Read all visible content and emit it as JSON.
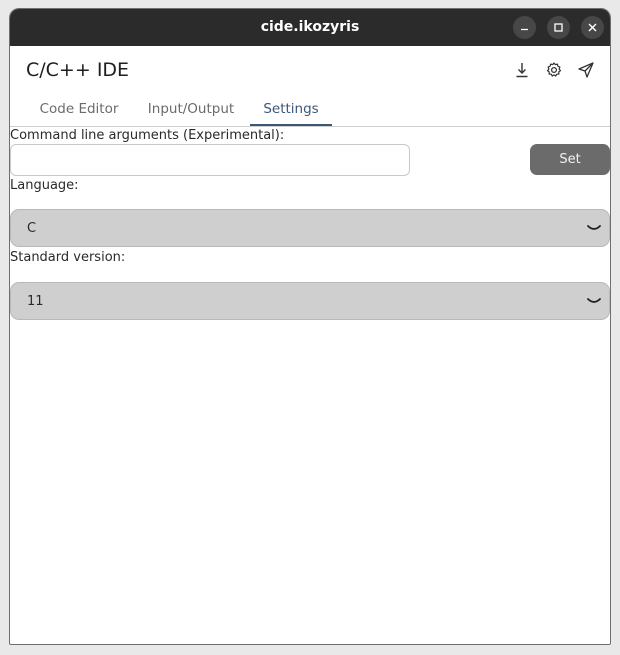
{
  "window": {
    "title": "cide.ikozyris"
  },
  "header": {
    "app_title": "C/C++ IDE"
  },
  "tabs": [
    {
      "label": "Code Editor",
      "active": false
    },
    {
      "label": "Input/Output",
      "active": false
    },
    {
      "label": "Settings",
      "active": true
    }
  ],
  "settings": {
    "args_label": "Command line arguments (Experimental):",
    "args_value": "",
    "set_label": "Set",
    "language_label": "Language:",
    "language_value": "C",
    "standard_label": "Standard version:",
    "standard_value": "11"
  },
  "colors": {
    "titlebar": "#2b2b2b",
    "accent": "#3b5778",
    "button": "#6b6b6b",
    "select_bg": "#cfcfcf"
  },
  "icons": [
    "minimize-icon",
    "maximize-icon",
    "close-icon",
    "download-icon",
    "gear-icon",
    "send-icon",
    "chevron-down-icon"
  ]
}
